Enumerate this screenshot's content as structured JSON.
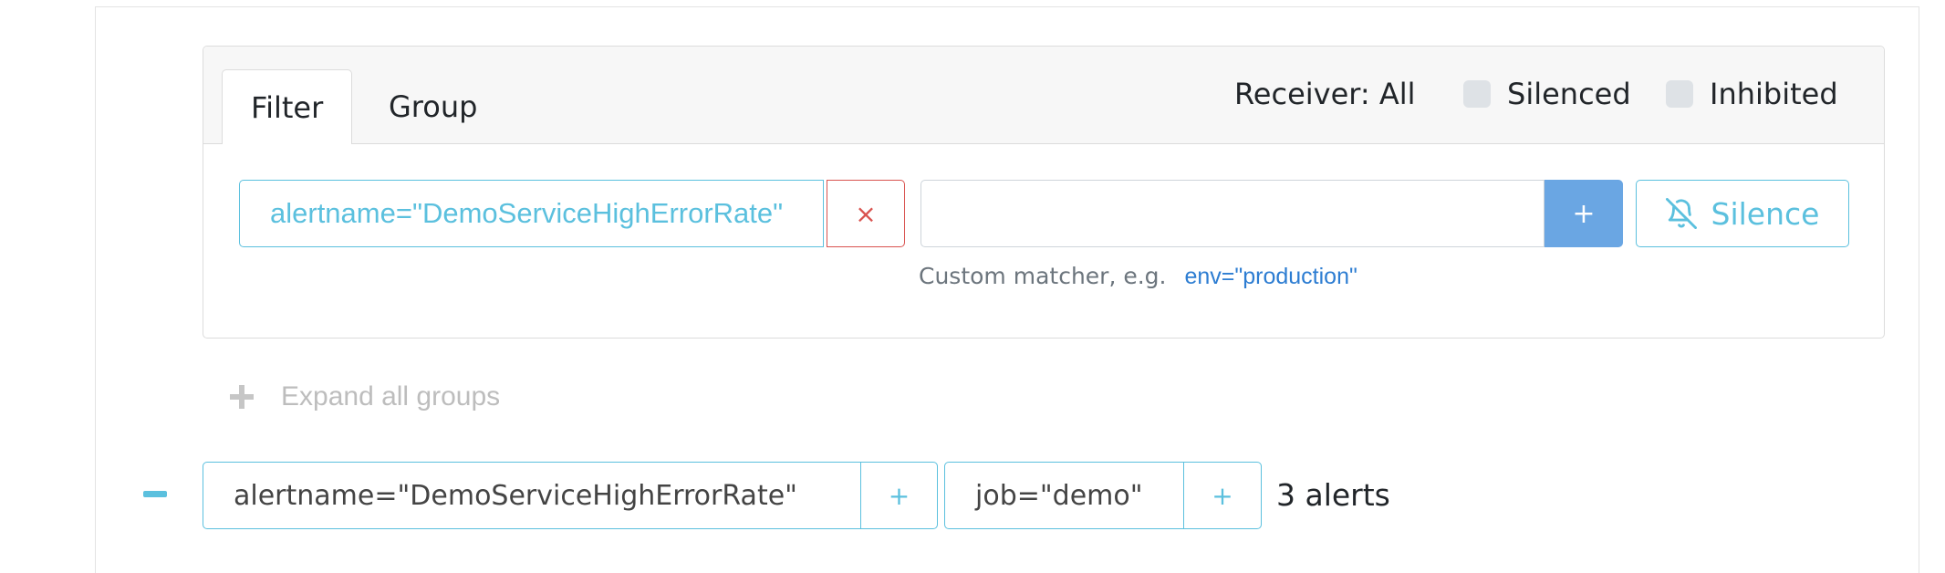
{
  "tabs": [
    {
      "label": "Filter",
      "active": true
    },
    {
      "label": "Group",
      "active": false
    }
  ],
  "toolbar": {
    "receiver_label": "Receiver: All",
    "silenced_label": "Silenced",
    "inhibited_label": "Inhibited"
  },
  "filter": {
    "chip_value": "alertname=\"DemoServiceHighErrorRate\"",
    "remove_glyph": "×",
    "matcher_input_value": "",
    "add_glyph": "+",
    "silence_label": "Silence",
    "hint_text": "Custom matcher, e.g.",
    "hint_example": "env=\"production\""
  },
  "groups": {
    "expand_all_label": "Expand all groups"
  },
  "alert_group": {
    "labels": [
      {
        "text": "alertname=\"DemoServiceHighErrorRate\"",
        "add_glyph": "+"
      },
      {
        "text": "job=\"demo\"",
        "add_glyph": "+"
      }
    ],
    "count_label": "3 alerts"
  },
  "colors": {
    "info": "#5bc0de",
    "danger": "#d9534f",
    "primary": "#6aa6e3",
    "link": "#2d7dd2"
  },
  "icons": {
    "remove": "close-icon",
    "add": "plus-icon",
    "silence": "bell-slash-icon",
    "expand": "plus-icon",
    "collapse": "minus-icon"
  }
}
